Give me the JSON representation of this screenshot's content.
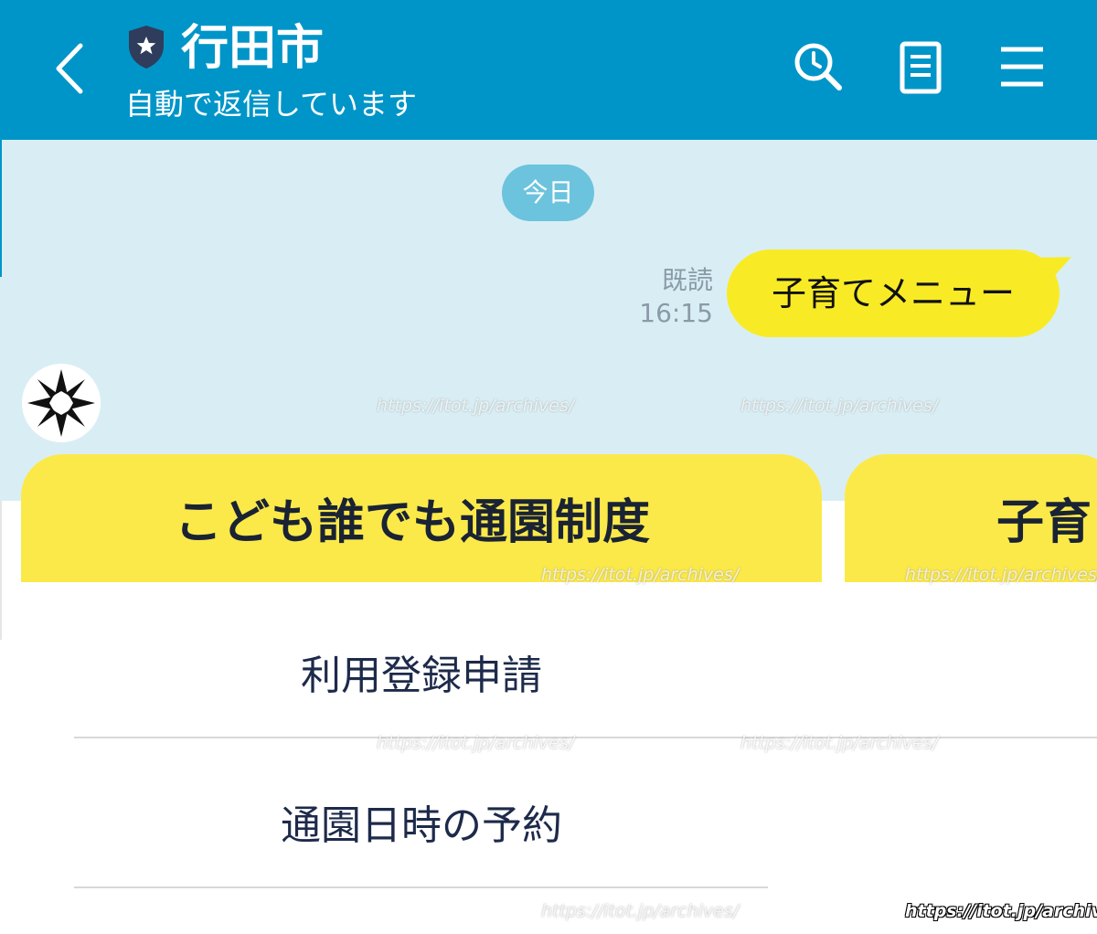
{
  "header": {
    "title": "行田市",
    "subtitle": "自動で返信しています",
    "back_icon": "chevron-left-icon",
    "badge_icon": "shield-star-icon",
    "search_icon": "search-clock-icon",
    "notes_icon": "notes-icon",
    "menu_icon": "hamburger-menu-icon",
    "bg_color": "#0095c8"
  },
  "chat": {
    "date_chip": "今日",
    "read_label": "既読",
    "time": "16:15",
    "user_message": "子育てメニュー",
    "bubble_color": "#f8eb26",
    "bg_color": "#d9eef4"
  },
  "cards": [
    {
      "title": "こども誰でも通園制度",
      "actions": [
        "利用登録申請",
        "通園日時の予約"
      ]
    },
    {
      "title": "子育"
    }
  ],
  "watermark": "https://itot.jp/archives/"
}
